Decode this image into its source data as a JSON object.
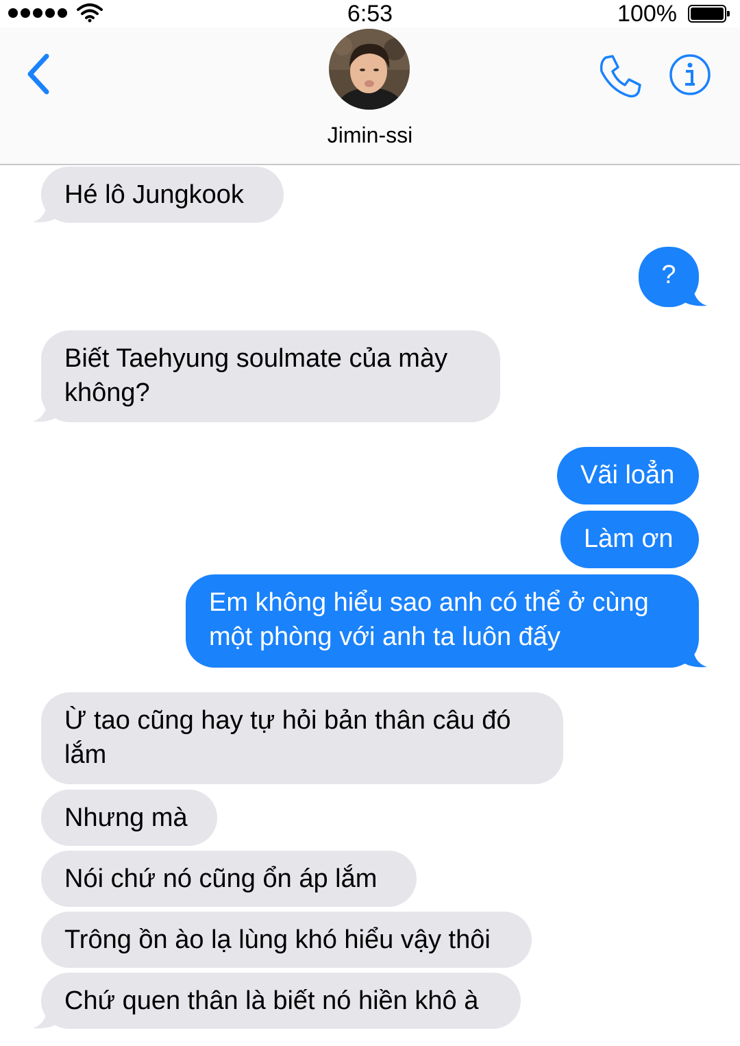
{
  "status_bar": {
    "time": "6:53",
    "battery": "100%"
  },
  "header": {
    "contact_name": "Jimin-ssi",
    "back_icon": "chevron-left-icon",
    "phone_icon": "phone-icon",
    "info_icon": "info-icon"
  },
  "colors": {
    "outgoing": "#1a82fb",
    "incoming": "#e5e5ea",
    "accent": "#1a82fb"
  },
  "messages": [
    {
      "direction": "incoming",
      "lines": [
        "Hé lô Jungkook"
      ]
    },
    {
      "direction": "outgoing",
      "lines": [
        "?"
      ]
    },
    {
      "direction": "incoming",
      "lines": [
        "Biết Taehyung soulmate của mày",
        "không?"
      ]
    },
    {
      "direction": "outgoing",
      "lines": [
        "Vãi loẳn"
      ]
    },
    {
      "direction": "outgoing",
      "lines": [
        "Làm ơn"
      ]
    },
    {
      "direction": "outgoing",
      "lines": [
        "Em không hiểu sao anh có thể ở cùng",
        "một phòng với anh ta luôn đấy"
      ]
    },
    {
      "direction": "incoming",
      "lines": [
        "Ừ tao cũng hay tự hỏi bản thân câu đó",
        "lắm"
      ]
    },
    {
      "direction": "incoming",
      "lines": [
        "Nhưng mà"
      ]
    },
    {
      "direction": "incoming",
      "lines": [
        "Nói chứ nó cũng ổn áp lắm"
      ]
    },
    {
      "direction": "incoming",
      "lines": [
        "Trông ồn ào lạ lùng khó hiểu vậy thôi"
      ]
    },
    {
      "direction": "incoming",
      "lines": [
        "Chứ quen thân là biết nó hiền khô à"
      ]
    }
  ]
}
